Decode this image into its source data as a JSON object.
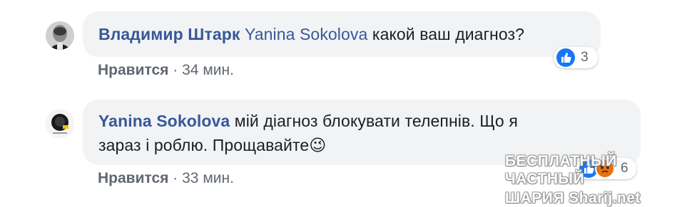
{
  "comments": [
    {
      "author": "Владимир Штарк",
      "mention": "Yanina Sokolova",
      "text": "какой ваш диагноз?",
      "actions": {
        "like_label": "Нравится",
        "separator": "·",
        "time": "34 мин."
      },
      "reactions": {
        "icons": [
          "like-icon"
        ],
        "count": "3"
      }
    },
    {
      "author": "Yanina Sokolova",
      "text_line1": "мій діагноз блокувати телепнів. Що я",
      "text_line2": "зараз і роблю. Прощавайте",
      "emoji": "😉",
      "actions": {
        "like_label": "Нравится",
        "separator": "·",
        "time": "33 мин."
      },
      "reactions": {
        "icons": [
          "like-icon",
          "angry-icon"
        ],
        "count": "6"
      }
    }
  ],
  "watermark": {
    "line1": "БЕСПЛАТНЫЙ ЧАСТНЫЙ",
    "line2": "ШАРИЯ Sharij.net"
  },
  "colors": {
    "link_blue": "#385898",
    "bubble_bg": "#f2f3f5",
    "meta_gray": "#606770",
    "like_blue": "#1877f2",
    "angry_orange": "#e9710f"
  }
}
